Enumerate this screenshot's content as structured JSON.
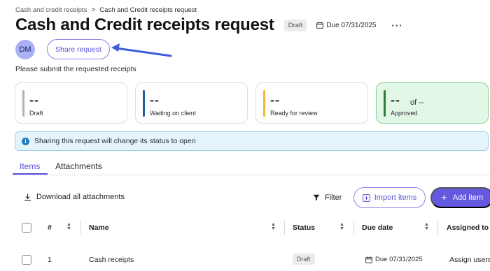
{
  "breadcrumb": {
    "parent": "Cash and credit receipts",
    "separator": ">",
    "current": "Cash and Credit receipts request"
  },
  "header": {
    "title": "Cash and Credit receipts request",
    "status_badge": "Draft",
    "due": "Due 07/31/2025",
    "more": "···"
  },
  "owner": {
    "avatar_initials": "DM",
    "share_label": "Share request"
  },
  "subtitle": "Please submit the requested receipts",
  "stats": [
    {
      "value": "--",
      "suffix": "",
      "label": "Draft",
      "color": "#b3b3b8"
    },
    {
      "value": "--",
      "suffix": "",
      "label": "Waiting on client",
      "color": "#1f5aa6"
    },
    {
      "value": "--",
      "suffix": "",
      "label": "Ready for review",
      "color": "#f2b82b"
    },
    {
      "value": "--",
      "suffix": "of --",
      "label": "Approved",
      "color": "#2e7d3a"
    }
  ],
  "banner": {
    "icon": "info-icon",
    "text": "Sharing this request will change its status to open"
  },
  "tabs": [
    {
      "label": "Items",
      "active": true
    },
    {
      "label": "Attachments",
      "active": false
    }
  ],
  "toolbar": {
    "download_label": "Download all attachments",
    "filter_label": "Filter",
    "import_label": "Import items",
    "add_label": "Add item"
  },
  "table": {
    "columns": [
      "#",
      "Name",
      "Status",
      "Due date",
      "Assigned to"
    ],
    "rows": [
      {
        "num": "1",
        "name": "Cash receipts",
        "status": "Draft",
        "due": "Due 07/31/2025",
        "assigned": "Assign users"
      }
    ]
  },
  "colors": {
    "accent": "#5b55d6",
    "primary_button": "#6259e0",
    "banner_bg": "#e5f3fb",
    "approved_bg": "#e3f7e6"
  }
}
